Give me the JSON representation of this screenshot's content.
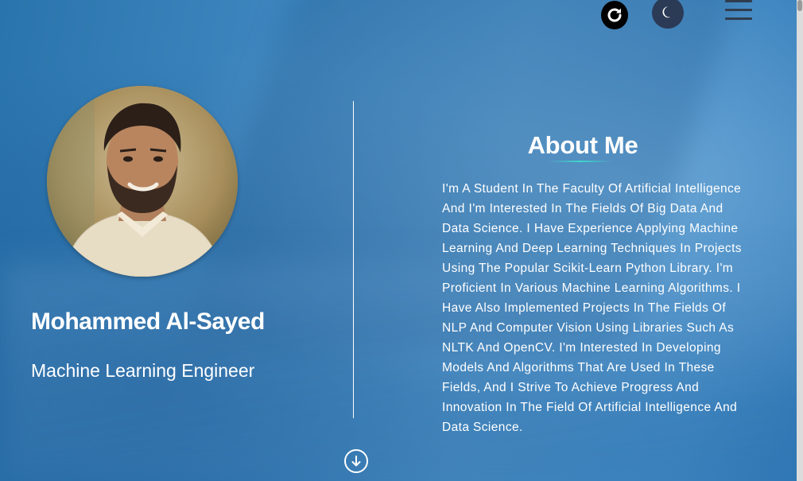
{
  "header": {
    "refresh_icon": "refresh-icon",
    "theme_icon": "moon-icon",
    "menu_icon": "hamburger-menu-icon"
  },
  "profile": {
    "name": "Mohammed Al-Sayed",
    "role": "Machine Learning Engineer"
  },
  "about": {
    "title": "About Me",
    "text": "I'm A Student In The Faculty Of Artificial Intelligence And I'm Interested In The Fields Of Big Data And Data Science. I Have Experience Applying Machine Learning And Deep Learning Techniques In Projects Using The Popular Scikit-Learn Python Library. I'm Proficient In Various Machine Learning Algorithms. I Have Also Implemented Projects In The Fields Of NLP And Computer Vision Using Libraries Such As NLTK And OpenCV. I'm Interested In Developing Models And Algorithms That Are Used In These Fields, And I Strive To Achieve Progress And Innovation In The Field Of Artificial Intelligence And Data Science."
  },
  "navigation": {
    "scroll_down_icon": "arrow-down-circle-icon"
  },
  "colors": {
    "background": "#3f87bf",
    "refresh_button": "#000000",
    "theme_button": "#2b3a55",
    "menu_lines": "#2f3c4e",
    "accent_underline": "#40d6c8"
  }
}
